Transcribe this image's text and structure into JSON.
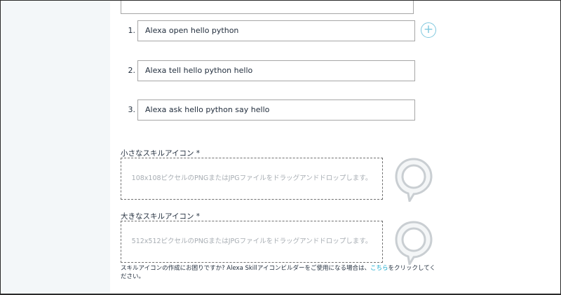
{
  "utterances": [
    {
      "number": "1.",
      "text": "Alexa open hello python"
    },
    {
      "number": "2.",
      "text": "Alexa tell hello python hello"
    },
    {
      "number": "3.",
      "text": "Alexa ask hello python say hello"
    }
  ],
  "add_button": {
    "symbol": "+"
  },
  "small_icon": {
    "label": "小さなスキルアイコン *",
    "dropzone_text": "108x108ピクセルのPNGまたはJPGファイルをドラッグアンドドロップします。"
  },
  "large_icon": {
    "label": "大きなスキルアイコン *",
    "dropzone_text": "512x512ピクセルのPNGまたはJPGファイルをドラッグアンドドロップします。"
  },
  "footer": {
    "before_link": "スキルアイコンの作成にお困りですか? Alexa Skillアイコンビルダーをご使用になる場合は、",
    "link_text": "こちら",
    "after_link": "をクリックしてください。"
  },
  "colors": {
    "sidebar_bg": "#f3f7f9",
    "accent": "#0ea5c9",
    "placeholder_text": "#a7adb3"
  }
}
